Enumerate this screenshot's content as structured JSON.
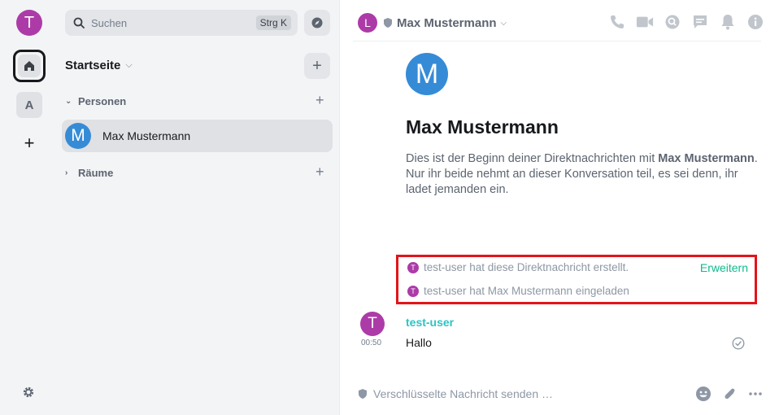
{
  "rail": {
    "user_initial": "T",
    "space_initial": "A",
    "add_label": "+"
  },
  "roomlist": {
    "search_placeholder": "Suchen",
    "search_shortcut": "Strg K",
    "home_title": "Startseite",
    "add_label": "+",
    "sections": [
      {
        "label": "Personen",
        "add": "+"
      },
      {
        "label": "Räume",
        "add": "+"
      }
    ],
    "rooms": [
      {
        "initial": "M",
        "name": "Max Mustermann"
      }
    ]
  },
  "header": {
    "avatar_initial": "L",
    "title": "Max Mustermann"
  },
  "intro": {
    "avatar_initial": "M",
    "name": "Max Mustermann",
    "line1_prefix": "Dies ist der Beginn deiner Direktnachrichten mit ",
    "line1_bold": "Max Mustermann",
    "line1_suffix": ".",
    "line2": "Nur ihr beide nehmt an dieser Konversation teil, es sei denn, ihr ladet jemanden ein."
  },
  "events": {
    "items": [
      {
        "initial": "T",
        "text": "test-user hat diese Direktnachricht erstellt."
      },
      {
        "initial": "T",
        "text": "test-user hat Max Mustermann eingeladen"
      }
    ],
    "expand_label": "Erweitern"
  },
  "message": {
    "avatar_initial": "T",
    "time": "00:50",
    "sender": "test-user",
    "body": "Hallo"
  },
  "composer": {
    "placeholder": "Verschlüsselte Nachricht senden …"
  },
  "colors": {
    "accent_green": "#0dbd8b",
    "sender_color": "#2dc2c5",
    "user_avatar": "#ac3ba8",
    "room_avatar": "#368bd6",
    "highlight_box": "#e3141a"
  },
  "icons": {
    "header": [
      "phone-icon",
      "video-icon",
      "threads-icon",
      "chat-icon",
      "bell-icon",
      "info-icon"
    ],
    "composer": [
      "emoji-icon",
      "attachment-icon",
      "more-options-icon"
    ]
  }
}
